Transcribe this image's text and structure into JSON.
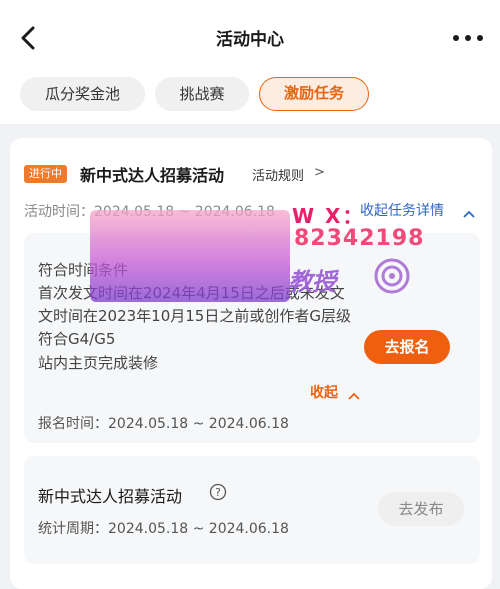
{
  "header": {
    "title": "活动中心"
  },
  "tabs": [
    {
      "label": "瓜分奖金池",
      "active": false
    },
    {
      "label": "挑战赛",
      "active": false
    },
    {
      "label": "激励任务",
      "active": true
    }
  ],
  "activity": {
    "status_badge": "进行中",
    "name": "新中式达人招募活动",
    "rules_link": "活动规则",
    "rules_chevron": ">",
    "time_label": "活动时间：2024.05.18 ~ 2024.06.18",
    "collapse_task_details": "收起任务详情",
    "requirements": [
      "符合时间条件",
      "首次发文时间在2024年4月15日之后或未发文",
      "文时间在2023年10月15日之前或创作者G层级",
      "符合G4/G5",
      "站内主页完成装修"
    ],
    "signup_button": "去报名",
    "collapse_label": "收起",
    "registration_time": "报名时间：2024.05.18 ~ 2024.06.18"
  },
  "task": {
    "title": "新中式达人招募活动",
    "stat_period": "统计周期：2024.05.18 ~ 2024.06.18",
    "publish_button": "去发布"
  },
  "watermark": {
    "wx_label": "W X：",
    "wx_number": "82342198",
    "subtitle": "教授"
  },
  "colors": {
    "accent": "#ea6411",
    "link": "#2f66c7",
    "badge": "#f07a2b"
  }
}
